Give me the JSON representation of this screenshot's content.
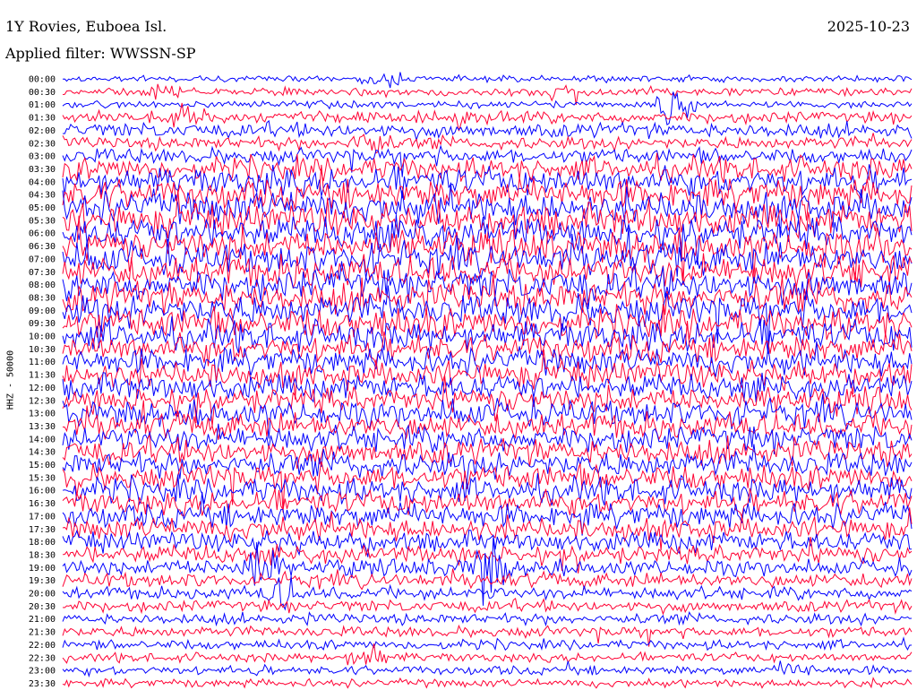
{
  "header": {
    "station": "1Y Rovies, Euboea Isl.",
    "date": "2025-10-23",
    "filter": "Applied filter: WWSSN-SP"
  },
  "chart_data": {
    "type": "line",
    "title": "1Y Rovies, Euboea Isl.",
    "ylabel": "HHZ - 50000",
    "xlabel": "",
    "line_colors": [
      "#0000ff",
      "#ff0033"
    ],
    "row_labels": [
      "00:00",
      "00:30",
      "01:00",
      "01:30",
      "02:00",
      "02:30",
      "03:00",
      "03:30",
      "04:00",
      "04:30",
      "05:00",
      "05:30",
      "06:00",
      "06:30",
      "07:00",
      "07:30",
      "08:00",
      "08:30",
      "09:00",
      "09:30",
      "10:00",
      "10:30",
      "11:00",
      "11:30",
      "12:00",
      "12:30",
      "13:00",
      "13:30",
      "14:00",
      "14:30",
      "15:00",
      "15:30",
      "16:00",
      "16:30",
      "17:00",
      "17:30",
      "18:00",
      "18:30",
      "19:00",
      "19:30",
      "20:00",
      "20:30",
      "21:00",
      "21:30",
      "22:00",
      "22:30",
      "23:00",
      "23:30"
    ],
    "noise_level": [
      0.3,
      0.5,
      0.4,
      0.9,
      1.2,
      1.0,
      1.3,
      2.2,
      2.6,
      2.8,
      3.0,
      3.0,
      3.0,
      3.0,
      3.0,
      3.0,
      3.0,
      3.0,
      3.0,
      3.0,
      2.8,
      2.6,
      2.4,
      2.4,
      2.4,
      2.4,
      2.4,
      2.4,
      2.4,
      2.4,
      2.4,
      2.4,
      2.4,
      2.2,
      2.2,
      2.0,
      1.8,
      1.6,
      1.4,
      1.2,
      1.0,
      0.9,
      0.8,
      0.8,
      0.7,
      0.6,
      0.6,
      0.5
    ],
    "events": [
      {
        "row": 0,
        "time_fraction": 0.38,
        "amplitude": 1.5
      },
      {
        "row": 1,
        "time_fraction": 0.12,
        "amplitude": 1.2
      },
      {
        "row": 1,
        "time_fraction": 0.58,
        "amplitude": 1.0
      },
      {
        "row": 2,
        "time_fraction": 0.72,
        "amplitude": 6.0
      },
      {
        "row": 3,
        "time_fraction": 0.15,
        "amplitude": 1.5
      },
      {
        "row": 3,
        "time_fraction": 0.48,
        "amplitude": 1.5
      },
      {
        "row": 5,
        "time_fraction": 0.36,
        "amplitude": 3.0
      },
      {
        "row": 38,
        "time_fraction": 0.23,
        "amplitude": 6.0
      },
      {
        "row": 38,
        "time_fraction": 0.5,
        "amplitude": 6.0
      },
      {
        "row": 40,
        "time_fraction": 0.26,
        "amplitude": 3.0
      },
      {
        "row": 45,
        "time_fraction": 0.36,
        "amplitude": 3.0
      },
      {
        "row": 46,
        "time_fraction": 0.86,
        "amplitude": 1.5
      }
    ]
  }
}
